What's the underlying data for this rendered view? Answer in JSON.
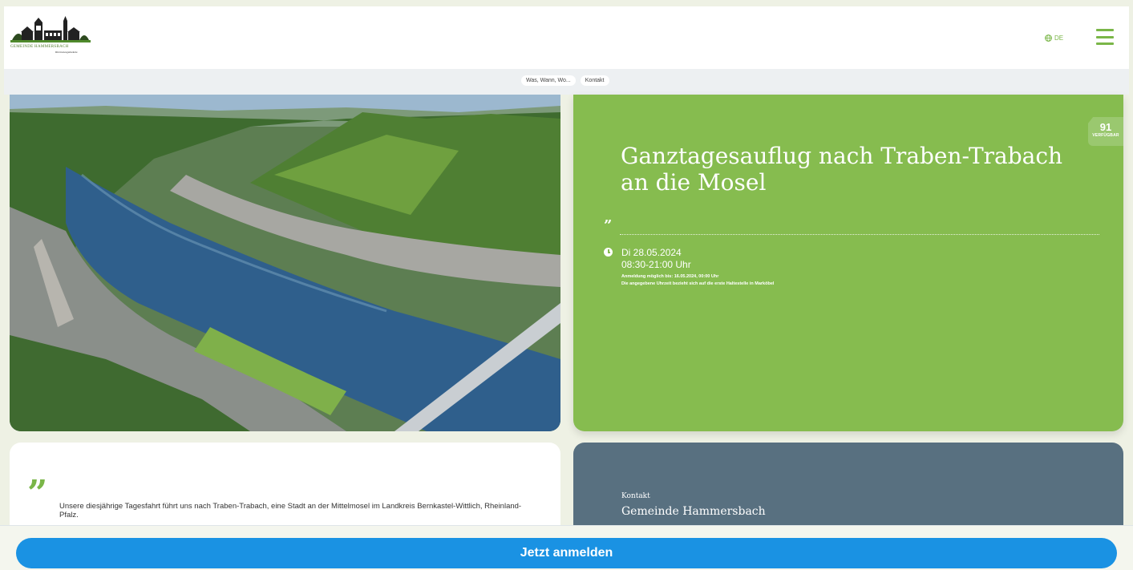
{
  "header": {
    "logo_text": "GEMEINDE HAMMERSBACH",
    "logo_sub": "Rhönwiesgemeinde",
    "language": "DE",
    "accent_color": "#7ab648"
  },
  "nav": {
    "links": [
      "Was, Wann, Wo...",
      "Kontakt"
    ]
  },
  "event": {
    "badge_count": "91",
    "badge_label": "VERFÜGBAR",
    "title": "Ganztagesauflug nach Traben-Trabach an die Mosel",
    "date": "Di 28.05.2024",
    "time": "08:30-21:00 Uhr",
    "registration_note": "Anmeldung möglich bis: 16.05.2024, 00:00 Uhr",
    "time_note": "Die angegebene Uhrzeit bezieht sich auf die erste Haltestelle in Marköbel",
    "card_color": "#86bc4f"
  },
  "description": {
    "text": "Unsere diesjährige Tagesfahrt führt uns nach Traben-Trabach, eine Stadt an der Mittelmosel im Landkreis Bernkastel-Wittlich, Rheinland-Pfalz."
  },
  "contact": {
    "label": "Kontakt",
    "name": "Gemeinde Hammersbach",
    "card_color": "#587080"
  },
  "cta": {
    "label": "Jetzt anmelden",
    "color": "#1a92e3"
  },
  "icons": {
    "globe": "globe-icon",
    "menu": "hamburger-menu-icon",
    "clock": "clock-icon",
    "quote": "quote-icon"
  }
}
